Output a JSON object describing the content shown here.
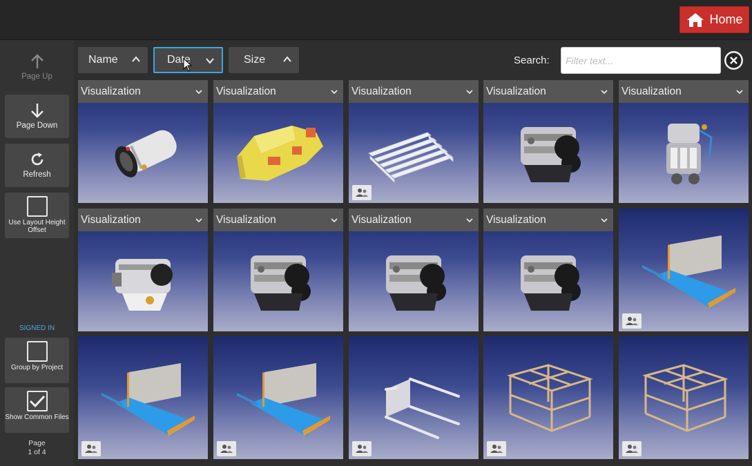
{
  "topbar": {
    "home_label": "Home"
  },
  "sidebar": {
    "page_up": "Page Up",
    "page_down": "Page Down",
    "refresh": "Refresh",
    "use_layout_height": "Use Layout Height Offset",
    "signed_in": "SIGNED IN",
    "group_by_project": "Group by Project",
    "show_common_files": "Show Common Files",
    "page_label": "Page",
    "page_value": "1 of 4"
  },
  "toolbar": {
    "sort_name": "Name",
    "sort_date": "Date",
    "sort_size": "Size",
    "search_label": "Search:",
    "search_placeholder": "Filter text..."
  },
  "tiles": [
    {
      "header": "Visualization",
      "model": "engine-cylinder",
      "shared": false
    },
    {
      "header": "Visualization",
      "model": "yellow-part",
      "shared": false
    },
    {
      "header": "Visualization",
      "model": "pallet",
      "shared": true
    },
    {
      "header": "Visualization",
      "model": "engine-block",
      "shared": false
    },
    {
      "header": "Visualization",
      "model": "engine-tall",
      "shared": false
    },
    {
      "header": "Visualization",
      "model": "engine-block-side",
      "shared": false
    },
    {
      "header": "Visualization",
      "model": "engine-block",
      "shared": false
    },
    {
      "header": "Visualization",
      "model": "engine-block",
      "shared": false
    },
    {
      "header": "Visualization",
      "model": "engine-block",
      "shared": false
    },
    {
      "header": "",
      "model": "bench",
      "shared": true
    },
    {
      "header": "",
      "model": "bench",
      "shared": true
    },
    {
      "header": "",
      "model": "bench",
      "shared": true
    },
    {
      "header": "",
      "model": "rails",
      "shared": true
    },
    {
      "header": "",
      "model": "frame",
      "shared": true
    },
    {
      "header": "",
      "model": "frame",
      "shared": true
    }
  ],
  "colors": {
    "home": "#c9302c",
    "accent": "#3aa8e0",
    "signed_in": "#4ea6d8"
  }
}
